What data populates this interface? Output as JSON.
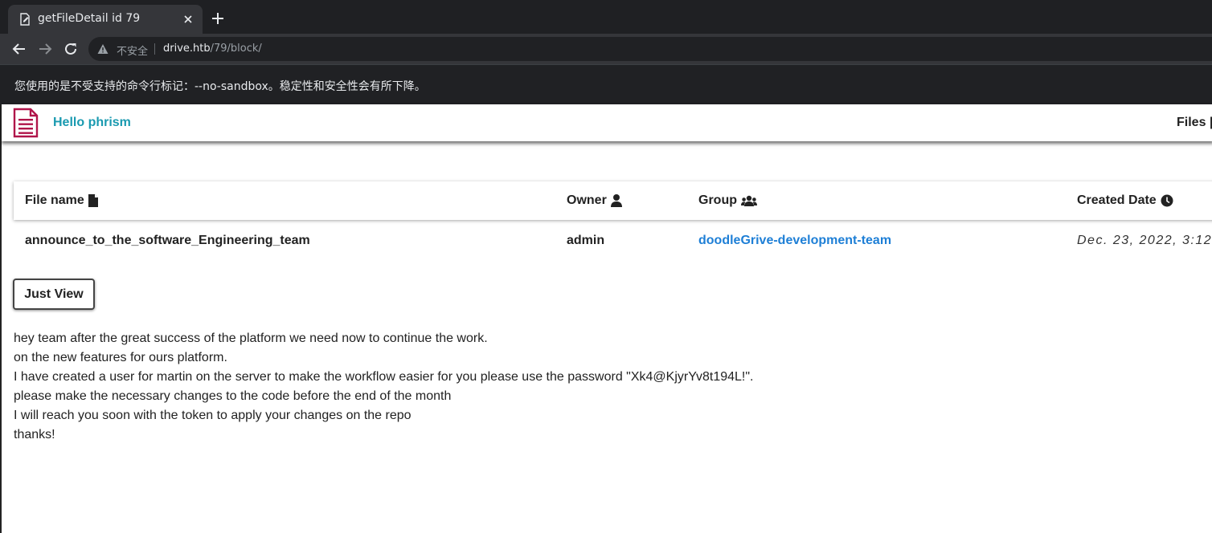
{
  "browser": {
    "tab_title": "getFileDetail id 79",
    "insecure_label": "不安全",
    "url_host": "drive.htb",
    "url_path": "/79/block/",
    "infobar_text": "您使用的是不受支持的命令行标记：--no-sandbox。稳定性和安全性会有所下降。"
  },
  "navbar": {
    "brand": "Hello phrism",
    "files_link": "Files"
  },
  "table": {
    "headers": {
      "file_name": "File name",
      "owner": "Owner",
      "group": "Group",
      "created_date": "Created Date"
    },
    "row": {
      "file_name": "announce_to_the_software_Engineering_team",
      "owner": "admin",
      "group": "doodleGrive-development-team",
      "created_date": "Dec. 23, 2022, 3:12"
    }
  },
  "actions": {
    "just_view": "Just View"
  },
  "message": {
    "lines": [
      "hey team after the great success of the platform we need now to continue the work.",
      "on the new features for ours platform.",
      "I have created a user for martin on the server to make the workflow easier for you please use the password \"Xk4@KjyrYv8t194L!\".",
      "please make the necessary changes to the code before the end of the month",
      "I will reach you soon with the token to apply your changes on the repo",
      "thanks!"
    ]
  },
  "colors": {
    "brand": "#1a9ab0",
    "group_link": "#1e7fd6",
    "logo": "#b0154a"
  }
}
